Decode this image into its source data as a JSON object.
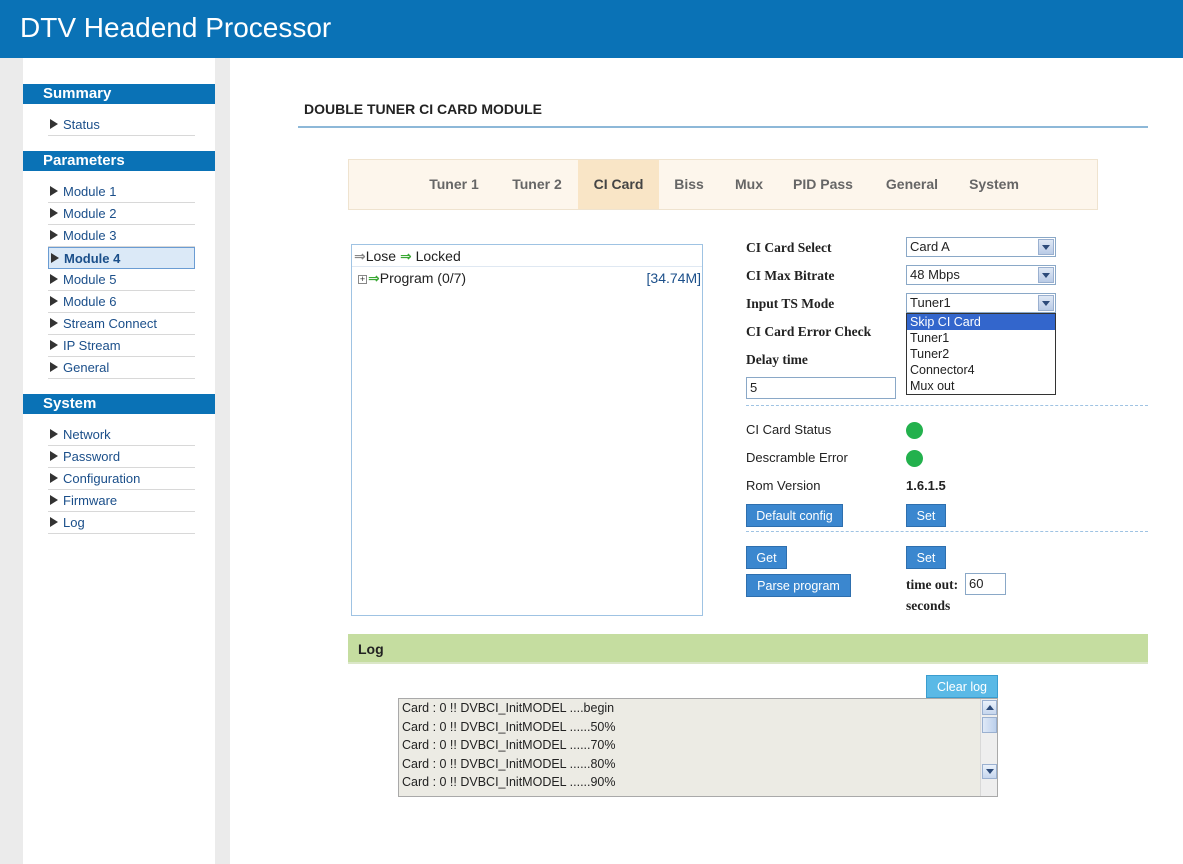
{
  "app": {
    "title": "DTV Headend Processor"
  },
  "sidebar": {
    "summary": {
      "heading": "Summary",
      "items": [
        {
          "label": "Status"
        }
      ]
    },
    "parameters": {
      "heading": "Parameters",
      "items": [
        {
          "label": "Module 1"
        },
        {
          "label": "Module 2"
        },
        {
          "label": "Module 3"
        },
        {
          "label": "Module 4",
          "active": true
        },
        {
          "label": "Module 5"
        },
        {
          "label": "Module 6"
        },
        {
          "label": "Stream Connect"
        },
        {
          "label": "IP Stream"
        },
        {
          "label": "General"
        }
      ]
    },
    "system": {
      "heading": "System",
      "items": [
        {
          "label": "Network"
        },
        {
          "label": "Password"
        },
        {
          "label": "Configuration"
        },
        {
          "label": "Firmware"
        },
        {
          "label": "Log"
        }
      ]
    }
  },
  "page": {
    "title": "DOUBLE TUNER CI CARD MODULE"
  },
  "tabs": [
    {
      "label": "Tuner 1"
    },
    {
      "label": "Tuner 2"
    },
    {
      "label": "CI Card",
      "active": true
    },
    {
      "label": "Biss"
    },
    {
      "label": "Mux"
    },
    {
      "label": "PID Pass"
    },
    {
      "label": "General"
    },
    {
      "label": "System"
    }
  ],
  "tree": {
    "legend_lose": "Lose",
    "legend_locked": "Locked",
    "program_label": "Program (0/7)",
    "bitrate": "[34.74M]"
  },
  "form": {
    "ci_card_select": {
      "label": "CI Card Select",
      "value": "Card A"
    },
    "ci_max_bitrate": {
      "label": "CI Max Bitrate",
      "value": "48 Mbps"
    },
    "input_ts_mode": {
      "label": "Input TS Mode",
      "value": "Tuner1",
      "options": [
        "Skip CI Card",
        "Tuner1",
        "Tuner2",
        "Connector4",
        "Mux out"
      ],
      "highlighted": "Skip CI Card"
    },
    "ci_card_error_check": {
      "label": "CI Card Error Check"
    },
    "delay_time": {
      "label": "Delay time",
      "value": "5"
    }
  },
  "status": {
    "ci_card_status": {
      "label": "CI Card Status",
      "color": "#23b14d"
    },
    "descramble_error": {
      "label": "Descramble Error",
      "color": "#23b14d"
    },
    "rom_version": {
      "label": "Rom Version",
      "value": "1.6.1.5"
    }
  },
  "buttons": {
    "default_config": "Default config",
    "set_1": "Set",
    "get": "Get",
    "set_2": "Set",
    "parse_program": "Parse program",
    "clear_log": "Clear log"
  },
  "timeout": {
    "label": "time out:",
    "value": "60",
    "unit": "seconds"
  },
  "log": {
    "heading": "Log",
    "lines": [
      "Card : 0 !! DVBCI_InitMODEL ....begin",
      "Card : 0 !! DVBCI_InitMODEL ......50%",
      "Card : 0 !! DVBCI_InitMODEL ......70%",
      "Card : 0 !! DVBCI_InitMODEL ......80%",
      "Card : 0 !! DVBCI_InitMODEL ......90%"
    ]
  }
}
